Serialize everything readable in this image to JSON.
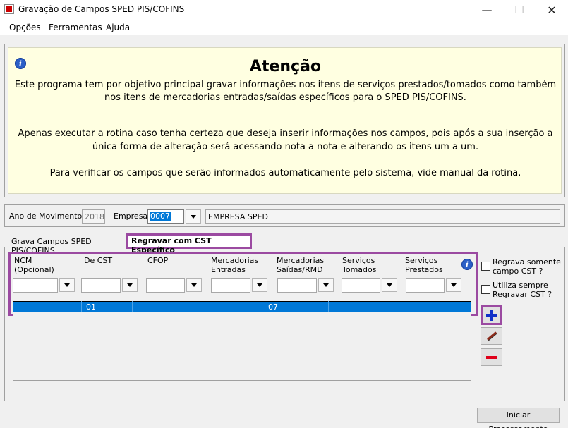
{
  "window": {
    "title": "Gravação de Campos SPED PIS/COFINS",
    "min_symbol": "—",
    "max_symbol": "☐",
    "close_symbol": "✕"
  },
  "menu": [
    "Opções",
    "Ferramentas",
    "Ajuda"
  ],
  "warning": {
    "info_symbol": "i",
    "title": "Atenção",
    "lines": [
      "Este programa tem por objetivo principal gravar informações nos itens de serviços prestados/tomados como também",
      "nos itens de mercadorias entradas/saídas específicos para o SPED PIS/COFINS.",
      "Apenas executar a rotina caso tenha certeza que deseja inserir informações nos campos, pois após a sua inserção a",
      "única forma de alteração será acessando nota a nota e alterando os itens um a um.",
      "Para verificar os campos que serão informados automaticamente pelo sistema, vide manual da rotina."
    ]
  },
  "filter": {
    "year_label": "Ano de Movimento:",
    "year_value": "2018",
    "company_label": "Empresa:",
    "company_code": "0007",
    "company_name": "EMPRESA SPED"
  },
  "tabs": [
    "Grava Campos SPED PIS/COFINS",
    "Regravar com CST Específico"
  ],
  "columns": [
    {
      "line1": "NCM",
      "line2": "(Opcional)"
    },
    {
      "line1": "De CST",
      "line2": ""
    },
    {
      "line1": "CFOP",
      "line2": ""
    },
    {
      "line1": "Mercadorias",
      "line2": "Entradas"
    },
    {
      "line1": "Mercadorias",
      "line2": "Saídas/RMD"
    },
    {
      "line1": "Serviços",
      "line2": "Tomados"
    },
    {
      "line1": "Serviços",
      "line2": "Prestados"
    }
  ],
  "grid_row": [
    "",
    "01",
    "",
    "",
    "07",
    "",
    ""
  ],
  "options": {
    "regrava_line1": "Regrava somente",
    "regrava_line2": "campo CST ?",
    "regrava_checked": false,
    "utiliza_line1": "Utiliza sempre",
    "utiliza_line2": "Regravar CST ?",
    "utiliza_checked": false
  },
  "actions": {
    "add_icon": "plus-icon",
    "edit_icon": "pencil-icon",
    "delete_icon": "minus-icon"
  },
  "colors": {
    "highlight": "#9b4aa1",
    "selection": "#0078d7",
    "warning_bg": "#ffffe1"
  },
  "bottom_button": "Iniciar Processamento"
}
